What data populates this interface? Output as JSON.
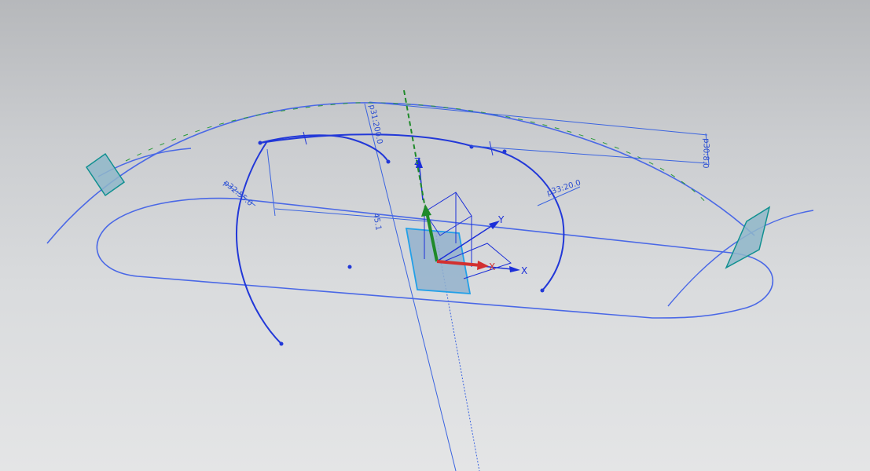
{
  "viewport": {
    "background_top": "#b6b8bb",
    "background_bottom": "#e4e5e6"
  },
  "colors": {
    "curve": "#2a3fd8",
    "guide_line": "#3a63e0",
    "dimension": "#2e4fd0",
    "datum_plane_fill": "#8fb7c9",
    "datum_plane_edge": "#109090",
    "x_axis": "#d23030",
    "z_axis": "#1f8a2a",
    "wcs": "#1c2fd8"
  },
  "dimensions": {
    "d_top_right": "p30:8.0",
    "d_top_center": "p31:200.0",
    "d_left": "p32:55.0",
    "d_right": "p33:20.0",
    "d_center": "45.1"
  },
  "axes": {
    "x": "X",
    "y": "Y",
    "z": "Z"
  }
}
